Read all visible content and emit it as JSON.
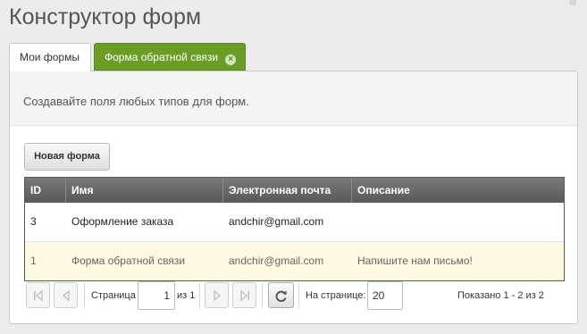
{
  "header": {
    "title": "Конструктор форм"
  },
  "tabs": [
    {
      "label": "Мои формы",
      "active": true
    },
    {
      "label": "Форма обратной связи",
      "closable": true,
      "color": "#6b9d25"
    }
  ],
  "panel": {
    "description": "Создавайте поля любых типов для форм.",
    "new_form_label": "Новая форма"
  },
  "grid": {
    "columns": [
      "ID",
      "Имя",
      "Электронная почта",
      "Описание"
    ],
    "rows": [
      {
        "id": "3",
        "name": "Оформление заказа",
        "email": "andchir@gmail.com",
        "description": ""
      },
      {
        "id": "1",
        "name": "Форма обратной связи",
        "email": "andchir@gmail.com",
        "description": "Напишите нам письмо!",
        "highlighted": true
      }
    ]
  },
  "pager": {
    "page_label": "Страница",
    "page_value": "1",
    "of_label": "из 1",
    "per_page_label": "На странице:",
    "per_page_value": "20",
    "shown_label": "Показано 1 - 2 из 2"
  },
  "icons": {
    "tab_close": "close-icon",
    "first": "first-page-icon",
    "prev": "prev-page-icon",
    "next": "next-page-icon",
    "last": "last-page-icon",
    "refresh": "refresh-icon"
  }
}
